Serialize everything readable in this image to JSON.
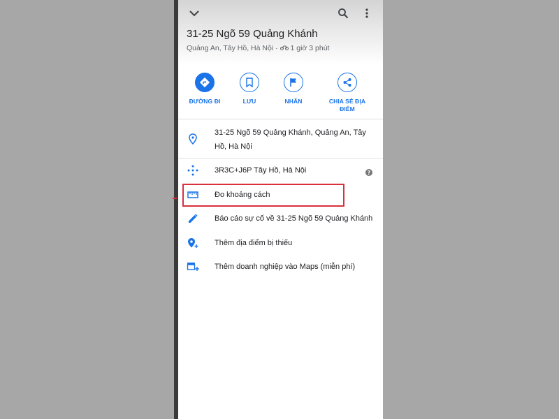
{
  "place": {
    "title": "31-25 Ngõ 59 Quảng Khánh",
    "subtitle": "Quảng An, Tây Hồ, Hà Nội ·",
    "travel_time": "1 giờ 3 phút"
  },
  "actions": [
    {
      "label": "ĐƯỜNG ĐI",
      "icon": "directions-icon"
    },
    {
      "label": "LƯU",
      "icon": "bookmark-icon"
    },
    {
      "label": "NHÃN",
      "icon": "flag-icon"
    },
    {
      "label": "CHIA SẺ ĐỊA ĐIỂM",
      "icon": "share-icon"
    }
  ],
  "details": {
    "address_line1": "31-25 Ngõ 59 Quảng Khánh, Quảng An, Tây",
    "address_line2": "Hồ, Hà Nội",
    "plus_code": "3R3C+J6P Tây Hồ, Hà Nội",
    "help_glyph": "?",
    "measure_distance": "Đo khoảng cách",
    "report_issue": "Báo cáo sự cố về 31-25 Ngõ 59 Quảng Khánh",
    "add_missing_place": "Thêm địa điểm bị thiếu",
    "add_business": "Thêm doanh nghiệp vào Maps (miễn phí)"
  },
  "colors": {
    "accent": "#1a73e8",
    "highlight": "#d9303e",
    "background": "#a7a7a7"
  }
}
